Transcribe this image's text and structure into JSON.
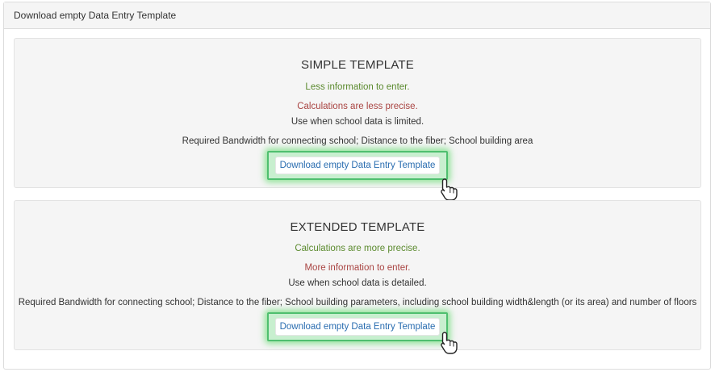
{
  "panel": {
    "heading": "Download empty Data Entry Template"
  },
  "simple": {
    "title": "SIMPLE TEMPLATE",
    "line1": "Less information to enter.",
    "line2": "Calculations are less precise.",
    "line3": "Use when school data is limited.",
    "line4": "Required Bandwidth for connecting school; Distance to the fiber; School building area",
    "button_label": "Download empty Data Entry Template"
  },
  "extended": {
    "title": "EXTENDED TEMPLATE",
    "line1": "Calculations are more precise.",
    "line2": "More information to enter.",
    "line3": "Use when school data is detailed.",
    "line4": "Required Bandwidth for connecting school; Distance to the fiber; School building parameters, including school building width&length (or its area) and number of floors",
    "button_label": "Download empty Data Entry Template"
  },
  "colors": {
    "positive_text": "#5b8a2e",
    "negative_text": "#a94442",
    "link_text": "#2a6db0",
    "highlight": "#4fbf6f"
  },
  "icons": {
    "cursor": "hand-pointer-cursor-icon"
  }
}
